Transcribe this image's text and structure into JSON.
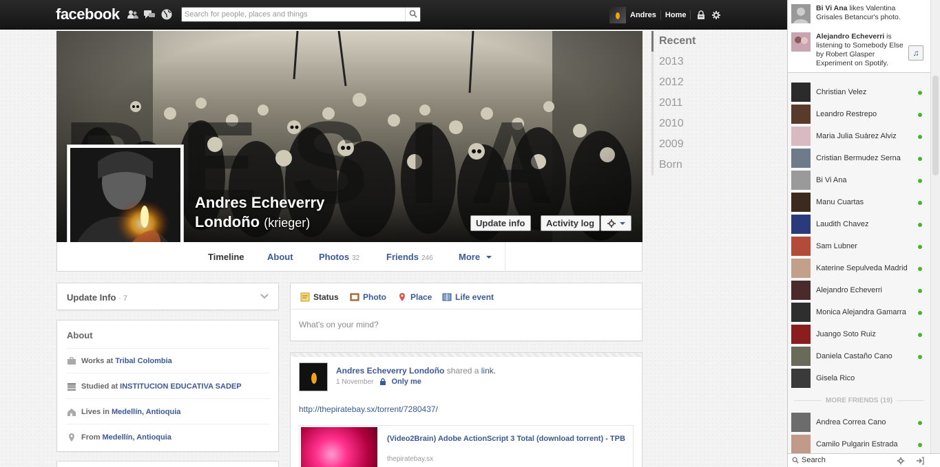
{
  "topbar": {
    "logo": "facebook",
    "search_placeholder": "Search for people, places and things",
    "user_name": "Andres",
    "home": "Home",
    "icons": [
      "friend-requests-icon",
      "messages-icon",
      "notifications-globe-icon",
      "privacy-lock-icon",
      "settings-gear-icon"
    ]
  },
  "profile": {
    "name_line1": "Andres Echeverry",
    "name_line2": "Londoño",
    "nickname": "(krieger)",
    "update_info_btn": "Update info",
    "activity_log_btn": "Activity log"
  },
  "tabs": [
    {
      "label": "Timeline"
    },
    {
      "label": "About"
    },
    {
      "label": "Photos",
      "count": "32"
    },
    {
      "label": "Friends",
      "count": "246"
    },
    {
      "label": "More"
    }
  ],
  "years": [
    "Recent",
    "2013",
    "2012",
    "2011",
    "2010",
    "2009",
    "Born"
  ],
  "left": {
    "update_info": "Update Info",
    "update_info_count": "· 7",
    "about_title": "About",
    "about_rows": [
      {
        "prefix": "Works at",
        "link": "Tribal Colombia"
      },
      {
        "prefix": "Studied at",
        "link": "INSTITUCION EDUCATIVA SADEP"
      },
      {
        "prefix": "Lives in",
        "link": "Medellín, Antioquia"
      },
      {
        "prefix": "From",
        "link": "Medellín, Antioquia"
      }
    ]
  },
  "composer": {
    "tabs": [
      "Status",
      "Photo",
      "Place",
      "Life event"
    ],
    "placeholder": "What's on your mind?"
  },
  "post": {
    "author": "Andres Echeverry Londoño",
    "action": "shared a",
    "action_link": "link.",
    "date": "1 November",
    "privacy": "Only me",
    "url": "http://thepiratebay.sx/torrent/7280437/",
    "link_title": "(Video2Brain) Adobe ActionScript 3 Total (download torrent) - TPB",
    "link_domain": "thepiratebay.sx"
  },
  "sidebar": {
    "ticker": [
      {
        "name": "Bi Vi Ana",
        "text": "likes Valentina Grisales Betancur's photo."
      },
      {
        "name": "Alejandro Echeverri",
        "text": "is listening to Somebody Else by Robert Glasper Experiment on Spotify."
      }
    ],
    "friends": [
      "Christian Velez",
      "Leandro Restrepo",
      "Maria Julia Suárez Alviz",
      "Cristian Bermudez Serna",
      "Bi Vi Ana",
      "Manu Cuartas",
      "Laudith Chavez",
      "Sam Lubner",
      "Katerine Sepulveda Madrid",
      "Alejandro Echeverri",
      "Monica Alejandra Gamarra",
      "Juango Soto Ruiz",
      "Daniela Castaño Cano",
      "Gisela Rico"
    ],
    "online": [
      true,
      true,
      true,
      true,
      true,
      true,
      true,
      true,
      true,
      true,
      true,
      true,
      true,
      false
    ],
    "more_friends": "MORE FRIENDS (19)",
    "more_list": [
      "Andrea Correa Cano",
      "Camilo Pulgarin Estrada"
    ],
    "search_label": "Search"
  }
}
